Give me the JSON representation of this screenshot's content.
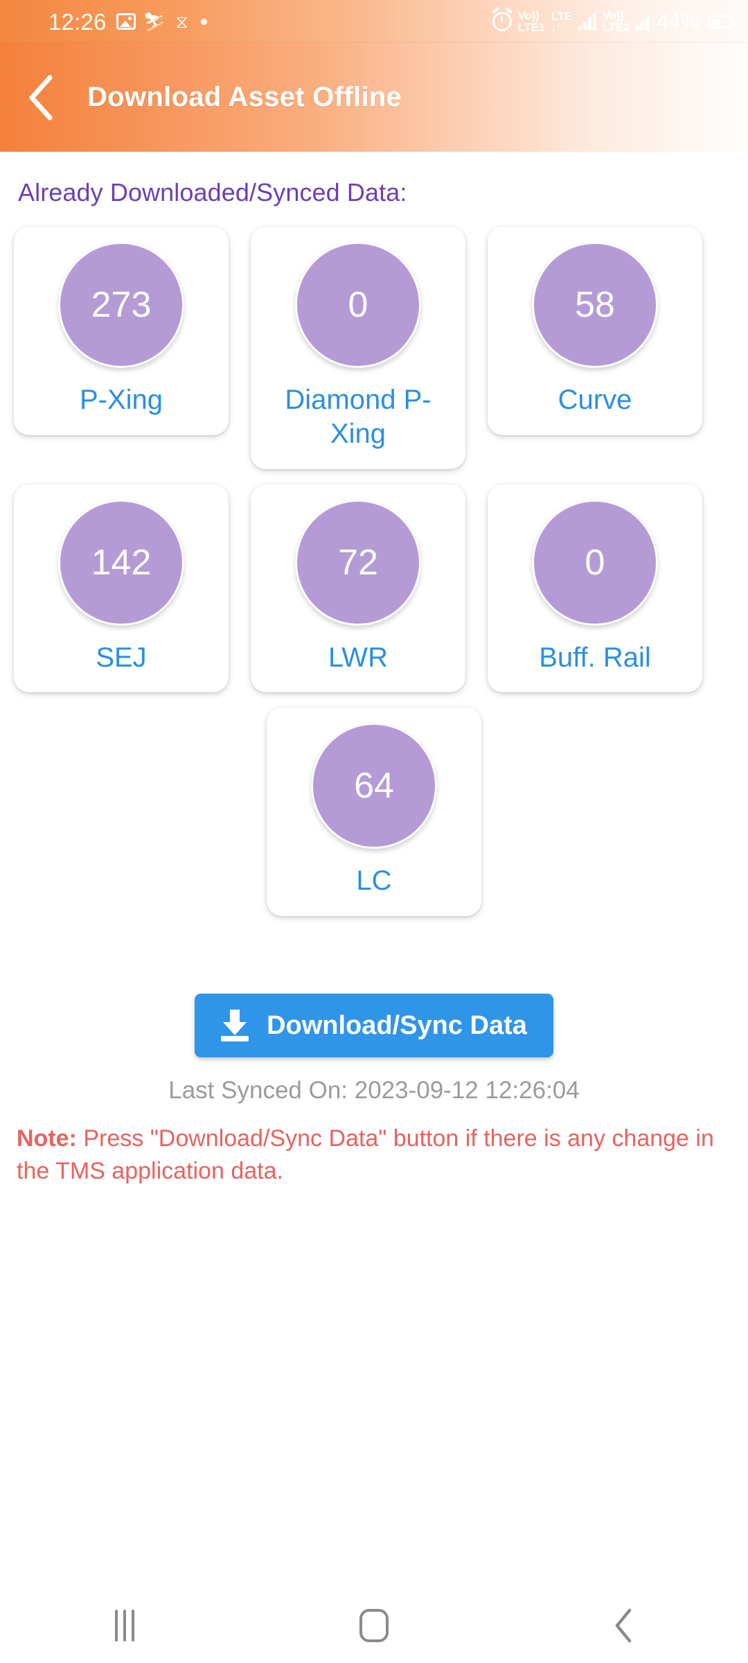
{
  "status_bar": {
    "time": "12:26",
    "icons_left": [
      "photo-icon",
      "person-running-icon",
      "spiral-icon",
      "dot-icon"
    ],
    "alarm_icon": "alarm-icon",
    "sim1_volte": "Vo))",
    "sim1_label": "LTE1",
    "network_type": "LTE",
    "data_arrows": "↓↑",
    "sim2_volte": "Vo))",
    "sim2_label": "LTE2",
    "battery_percent": "44%"
  },
  "app_bar": {
    "back_icon": "back-chevron-icon",
    "title": "Download Asset Offline"
  },
  "main": {
    "section_title": "Already Downloaded/Synced Data:",
    "cards": [
      {
        "count": "273",
        "label": "P-Xing"
      },
      {
        "count": "0",
        "label": "Diamond P-Xing"
      },
      {
        "count": "58",
        "label": "Curve"
      },
      {
        "count": "142",
        "label": "SEJ"
      },
      {
        "count": "72",
        "label": "LWR"
      },
      {
        "count": "0",
        "label": "Buff. Rail"
      },
      {
        "count": "64",
        "label": "LC"
      }
    ],
    "sync_button": {
      "icon": "download-icon",
      "label": "Download/Sync Data"
    },
    "last_synced": "Last Synced On: 2023-09-12 12:26:04",
    "note_prefix": "Note:",
    "note_text": " Press \"Download/Sync Data\" button if there is any change in the TMS application data."
  },
  "nav_bar": {
    "recents": "recents-icon",
    "home": "home-icon",
    "back": "back-icon"
  },
  "colors": {
    "header_start": "#F4813A",
    "header_end": "#FFFDFC",
    "bubble": "#b49bd6",
    "label_blue": "#2b8fe0",
    "title_purple": "#6b3fb5",
    "button_blue": "#2e95e8",
    "note_red": "#e8625e",
    "last_sync_gray": "#9b9b9b"
  }
}
